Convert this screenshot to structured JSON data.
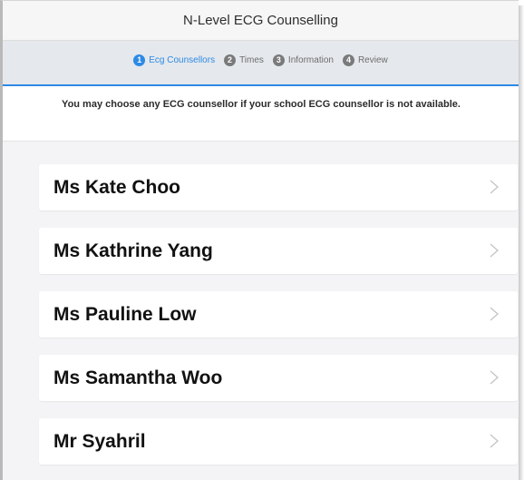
{
  "header": {
    "title": "N-Level ECG Counselling"
  },
  "steps": [
    {
      "number": "1",
      "label": "Ecg Counsellors",
      "active": true
    },
    {
      "number": "2",
      "label": "Times",
      "active": false
    },
    {
      "number": "3",
      "label": "Information",
      "active": false
    },
    {
      "number": "4",
      "label": "Review",
      "active": false
    }
  ],
  "notice": {
    "text": "You may choose any ECG counsellor if your school ECG counsellor is not available."
  },
  "counsellors": [
    {
      "name": "Ms Kate Choo",
      "icon": "chevron-right-icon"
    },
    {
      "name": "Ms Kathrine Yang",
      "icon": "chevron-right-icon"
    },
    {
      "name": "Ms Pauline Low",
      "icon": "chevron-right-icon"
    },
    {
      "name": "Ms Samantha Woo",
      "icon": "chevron-right-icon"
    },
    {
      "name": "Mr Syahril",
      "icon": "chevron-right-icon"
    }
  ],
  "colors": {
    "accent": "#2d8ae6",
    "inactive_step": "#7a7a7a",
    "background": "#f4f4f6"
  }
}
